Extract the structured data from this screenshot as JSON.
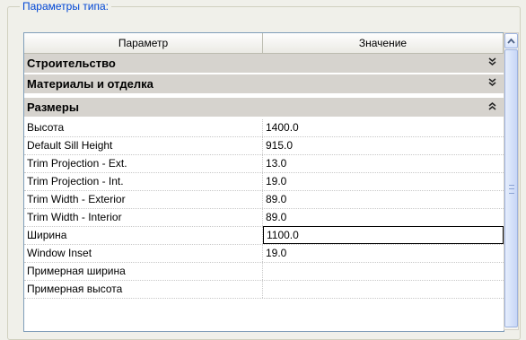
{
  "groupbox": {
    "title": "Параметры типа:"
  },
  "grid": {
    "columns": [
      "Параметр",
      "Значение"
    ],
    "groups": {
      "construction": {
        "label": "Строительство",
        "chevron": "»"
      },
      "materials": {
        "label": "Материалы и отделка",
        "chevron": "»"
      },
      "dimensions": {
        "label": "Размеры",
        "chevron": "«"
      }
    },
    "rows": [
      {
        "name": "Высота",
        "value": "1400.0"
      },
      {
        "name": "Default Sill Height",
        "value": "915.0"
      },
      {
        "name": "Trim Projection - Ext.",
        "value": "13.0"
      },
      {
        "name": "Trim Projection - Int.",
        "value": "19.0"
      },
      {
        "name": "Trim Width - Exterior",
        "value": "89.0"
      },
      {
        "name": "Trim Width - Interior",
        "value": "89.0"
      },
      {
        "name": "Ширина",
        "value": "1100.0"
      },
      {
        "name": "Window Inset",
        "value": "19.0"
      },
      {
        "name": "Примерная ширина",
        "value": ""
      },
      {
        "name": "Примерная высота",
        "value": ""
      }
    ]
  },
  "scrollbar": {
    "up_icon": "scroll-up-arrow"
  }
}
